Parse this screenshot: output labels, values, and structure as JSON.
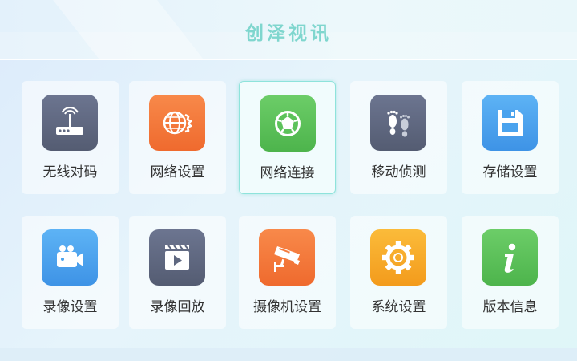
{
  "header": {
    "title": "创泽视讯"
  },
  "tiles": [
    {
      "label": "无线对码",
      "icon": "wireless-router-icon",
      "color": "#5f6880"
    },
    {
      "label": "网络设置",
      "icon": "network-globe-gear-icon",
      "color": "#f47a3c"
    },
    {
      "label": "网络连接",
      "icon": "network-connection-icon",
      "color": "#5cc25a"
    },
    {
      "label": "移动侦测",
      "icon": "footprints-icon",
      "color": "#5f6880"
    },
    {
      "label": "存储设置",
      "icon": "floppy-disk-icon",
      "color": "#4aa3ee"
    },
    {
      "label": "录像设置",
      "icon": "video-camera-icon",
      "color": "#4aa3ee"
    },
    {
      "label": "录像回放",
      "icon": "clapperboard-play-icon",
      "color": "#5f6880"
    },
    {
      "label": "摄像机设置",
      "icon": "security-camera-icon",
      "color": "#f47a3c"
    },
    {
      "label": "系统设置",
      "icon": "gear-icon",
      "color": "#f5a724"
    },
    {
      "label": "版本信息",
      "icon": "info-icon",
      "color": "#5cc25a"
    }
  ],
  "selected_tile": "网络连接"
}
